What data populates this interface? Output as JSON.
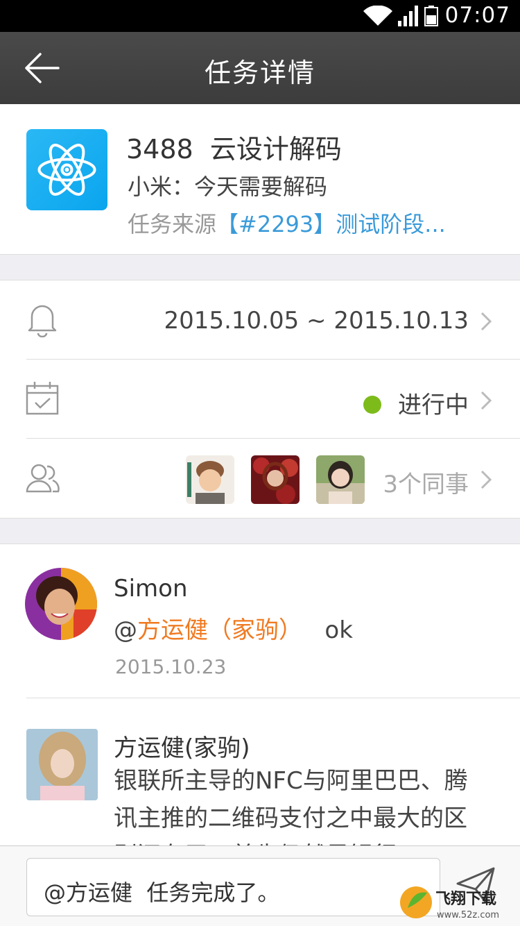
{
  "status_bar": {
    "time": "07:07"
  },
  "nav": {
    "title": "任务详情"
  },
  "task": {
    "title": "3488  云设计解码",
    "subtitle": "小米：今天需要解码",
    "source_label": "任务来源",
    "source_link": "【#2293】测试阶段..."
  },
  "rows": {
    "date_range": "2015.10.05 ~ 2015.10.13",
    "status": "进行中",
    "status_color": "#7dbb1b",
    "colleagues": "3个同事"
  },
  "comments": [
    {
      "author": "Simon",
      "at": "@",
      "mention": "方运健（家驹）",
      "message": "   ok",
      "date": "2015.10.23"
    },
    {
      "author": "方运健(家驹)",
      "body": "银联所主导的NFC与阿里巴巴、腾讯主推的二维码支付之中最大的区别还在于，首先仍然是银行"
    }
  ],
  "input": {
    "value": "@方运健  任务完成了。"
  },
  "watermark": {
    "brand": "飞翔下载",
    "url": "www.52z.com"
  }
}
